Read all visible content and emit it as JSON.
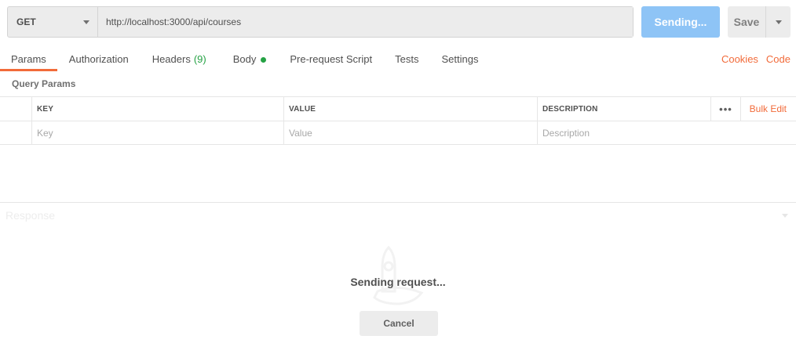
{
  "request": {
    "method": "GET",
    "url": "http://localhost:3000/api/courses",
    "send_label": "Sending...",
    "save_label": "Save"
  },
  "tabs": [
    {
      "label": "Params",
      "active": true
    },
    {
      "label": "Authorization"
    },
    {
      "label": "Headers",
      "count": "(9)"
    },
    {
      "label": "Body",
      "indicator": "green-dot"
    },
    {
      "label": "Pre-request Script"
    },
    {
      "label": "Tests"
    },
    {
      "label": "Settings"
    }
  ],
  "right_links": {
    "cookies": "Cookies",
    "code": "Code"
  },
  "params": {
    "title": "Query Params",
    "headers": {
      "key": "KEY",
      "value": "VALUE",
      "description": "DESCRIPTION",
      "more": "•••",
      "bulk_edit": "Bulk Edit"
    },
    "placeholders": {
      "key": "Key",
      "value": "Value",
      "description": "Description"
    }
  },
  "response": {
    "title": "Response",
    "status_text": "Sending request...",
    "cancel_label": "Cancel"
  },
  "colors": {
    "accent": "#f26b3a",
    "send_button": "#8ec4f6",
    "success": "#25a244"
  }
}
